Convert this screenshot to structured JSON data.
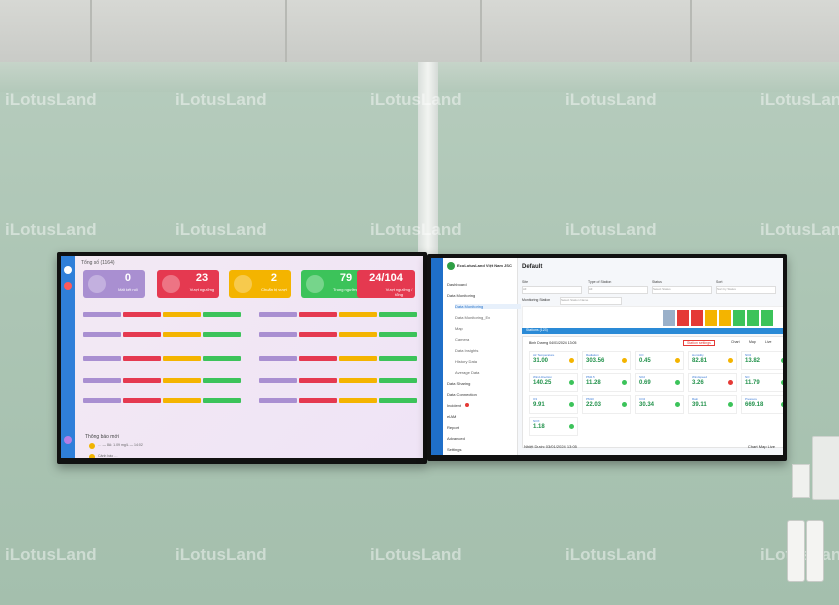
{
  "watermark": "iLotusLand",
  "left_screen": {
    "title": "Tổng số (1164)",
    "cards": [
      {
        "value": "0",
        "label": "Mất kết nối",
        "color": "#a98fd1"
      },
      {
        "value": "23",
        "label": "Vượt ngưỡng",
        "color": "#e53950"
      },
      {
        "value": "2",
        "label": "Chuẩn bị vượt",
        "color": "#f4b400"
      },
      {
        "value": "79",
        "label": "Trong ngưỡng",
        "color": "#3cc35a"
      },
      {
        "value": "24/104",
        "label": "Vượt ngưỡng / tổng",
        "color": "#e53950"
      }
    ],
    "events_title": "Thông báo mới",
    "events": [
      "… — 8A: 1.09 mg/L — 14:02",
      "Cảnh báo …"
    ]
  },
  "right_screen": {
    "brand": "EcoLotusLand Việt Nam JSC",
    "header": "Default",
    "filters": [
      {
        "label": "Site",
        "value": "All"
      },
      {
        "label": "Type of Station",
        "value": "All"
      },
      {
        "label": "Status",
        "value": "Select Status"
      },
      {
        "label": "Sort",
        "value": "Sort by Status"
      }
    ],
    "monitoring_label": "Monitoring Station",
    "monitoring_placeholder": "Select Station Name",
    "station_section": "Stations (123)",
    "menu": [
      {
        "label": "Dashboard",
        "sub": false,
        "badge": false
      },
      {
        "label": "Data Monitoring",
        "sub": false,
        "badge": false
      },
      {
        "label": "Data Monitoring",
        "sub": true,
        "badge": false,
        "active": true
      },
      {
        "label": "Data Monitoring_Ex",
        "sub": true,
        "badge": false
      },
      {
        "label": "Map",
        "sub": true,
        "badge": false
      },
      {
        "label": "Camera",
        "sub": true,
        "badge": false
      },
      {
        "label": "Data Insights",
        "sub": true,
        "badge": false
      },
      {
        "label": "History Data",
        "sub": true,
        "badge": false
      },
      {
        "label": "Average Data",
        "sub": true,
        "badge": false
      },
      {
        "label": "Data Sharing",
        "sub": false,
        "badge": false
      },
      {
        "label": "Data Connection",
        "sub": false,
        "badge": false
      },
      {
        "label": "Incident",
        "sub": false,
        "badge": true
      },
      {
        "label": "eIAM",
        "sub": false,
        "badge": false
      },
      {
        "label": "Report",
        "sub": false,
        "badge": false
      },
      {
        "label": "Advanced",
        "sub": false,
        "badge": false
      },
      {
        "label": "Settings",
        "sub": false,
        "badge": false
      }
    ],
    "panel_title": "Bình Dương 04/01/2024 13:05",
    "panel_buttons": [
      "Station settings",
      "Chart",
      "Map",
      "Live"
    ],
    "tiles": [
      {
        "name": "Air Temperature",
        "value": "31.00",
        "status": "#f4b400"
      },
      {
        "name": "Radiation",
        "value": "303.56",
        "status": "#f4b400"
      },
      {
        "name": "CO",
        "value": "0.45",
        "status": "#f4b400"
      },
      {
        "name": "Humidity",
        "value": "82.81",
        "status": "#f4b400"
      },
      {
        "name": "NO2",
        "value": "13.82",
        "status": "#3cc35a"
      },
      {
        "name": "Wind direction",
        "value": "140.25",
        "status": "#3cc35a"
      },
      {
        "name": "PM2.5",
        "value": "11.28",
        "status": "#3cc35a"
      },
      {
        "name": "SO2",
        "value": "0.69",
        "status": "#3cc35a"
      },
      {
        "name": "Windspeed",
        "value": "3.26",
        "status": "#e53935"
      },
      {
        "name": "NO",
        "value": "11.79",
        "status": "#3cc35a"
      },
      {
        "name": "O3",
        "value": "9.91",
        "status": "#3cc35a"
      },
      {
        "name": "PM10",
        "value": "22.03",
        "status": "#3cc35a"
      },
      {
        "name": "CO2",
        "value": "30.34",
        "status": "#3cc35a"
      },
      {
        "name": "Rain",
        "value": "39.11",
        "status": "#3cc35a"
      },
      {
        "name": "Pressure",
        "value": "669.18",
        "status": "#3cc35a"
      },
      {
        "name": "NOX",
        "value": "1.18",
        "status": "#3cc35a"
      }
    ],
    "footer_title": "Nhiệt Dước 03/01/2024 13:05",
    "footer_buttons": "Chart  Map  Live"
  }
}
